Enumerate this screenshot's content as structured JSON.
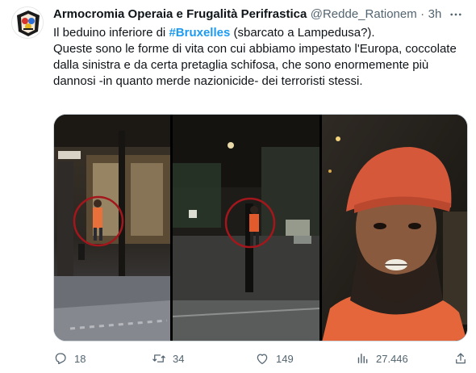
{
  "tweet": {
    "display_name": "Armocromia Operaia e Frugalità Perifrastica",
    "handle": "@Redde_Rationem",
    "separator": "·",
    "time": "3h",
    "text_before_hashtag": "Il beduino inferiore di ",
    "hashtag": "#Bruxelles",
    "text_after_hashtag": " (sbarcato a Lampedusa?).\nQueste sono le forme di vita con cui abbiamo impestato l'Europa, coccolate dalla sinistra e da certa pretaglia schifosa, che sono enormemente più dannosi  -in quanto merde nazionicide- dei terroristi stessi."
  },
  "actions": {
    "replies": "18",
    "retweets": "34",
    "likes": "149",
    "views": "27.446"
  },
  "colors": {
    "link": "#1d9bf0",
    "muted": "#536471",
    "text": "#0f1419",
    "highlight_circle": "#a3171c"
  },
  "icons": [
    "more-icon",
    "reply-icon",
    "retweet-icon",
    "like-icon",
    "views-icon",
    "share-icon"
  ]
}
